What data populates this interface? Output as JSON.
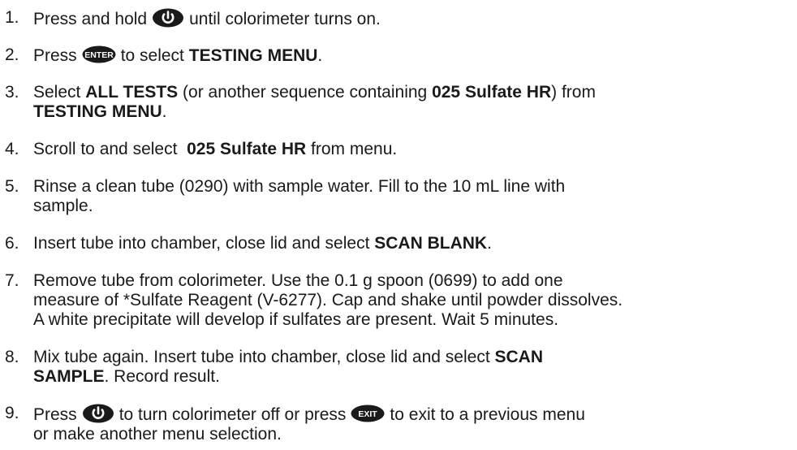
{
  "steps": [
    {
      "num": "1.",
      "a": "Press and hold",
      "icon": "power-icon",
      "b": "until colorimeter turns on."
    },
    {
      "num": "2.",
      "a": "Press",
      "key": "ENTER",
      "b": "to select",
      "bold1": "TESTING MENU",
      "c": "."
    },
    {
      "num": "3.",
      "a": "Select",
      "bold1": "ALL TESTS",
      "b": "(or another sequence containing",
      "bold2": "025 Sulfate HR",
      "c": ") from",
      "bold3": "TESTING MENU",
      "d": "."
    },
    {
      "num": "4.",
      "a": "Scroll to and select",
      "bold1": "025 Sulfate HR",
      "b": "from menu."
    },
    {
      "num": "5.",
      "line1": "Rinse a clean tube (0290) with sample water. Fill to the 10 mL line with",
      "line2": "sample."
    },
    {
      "num": "6.",
      "a": "Insert tube into chamber, close lid and select",
      "bold1": "SCAN BLANK",
      "b": "."
    },
    {
      "num": "7.",
      "line1": "Remove tube from colorimeter. Use the 0.1 g spoon (0699) to add one",
      "line2": "measure of *Sulfate Reagent (V-6277). Cap and shake until powder dissolves.",
      "line3": "A white precipitate will develop if sulfates are present. Wait 5 minutes."
    },
    {
      "num": "8.",
      "a": "Mix tube again. Insert tube into chamber, close lid and select",
      "bold1": "SCAN",
      "bold2": "SAMPLE",
      "b": ". Record result."
    },
    {
      "num": "9.",
      "a": "Press",
      "icon": "power-icon",
      "b": "to turn colorimeter off or press",
      "key": "EXIT",
      "c": "to exit to a previous menu",
      "line2": "or make another menu selection."
    }
  ]
}
